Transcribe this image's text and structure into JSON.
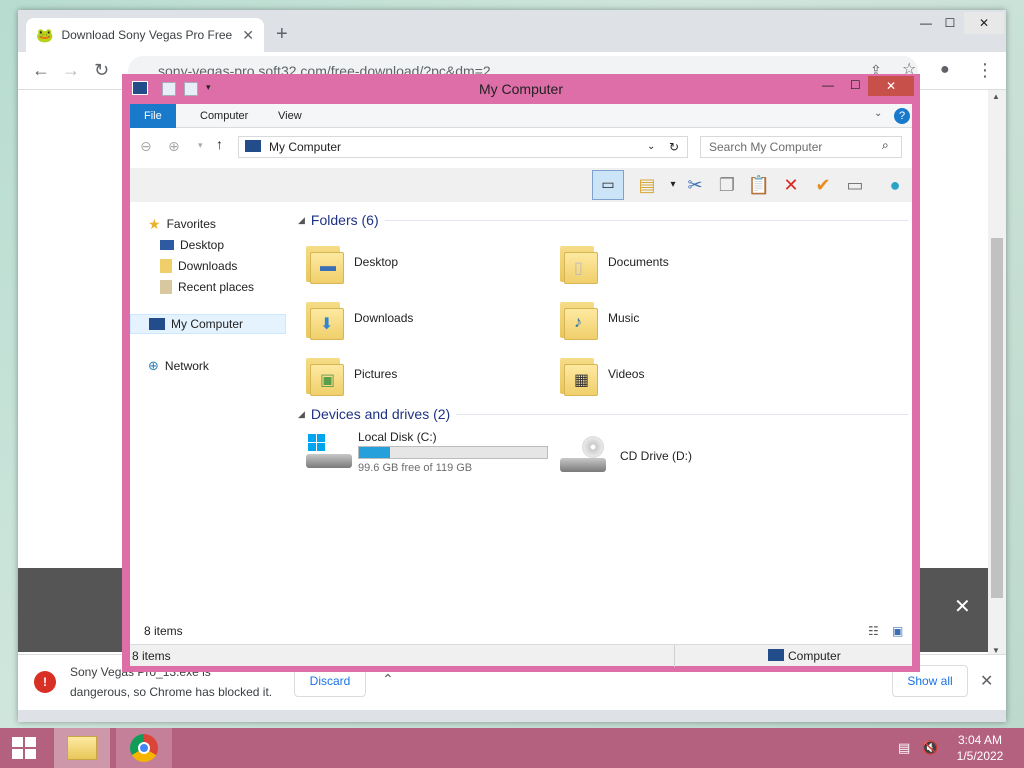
{
  "chrome": {
    "tab_title": "Download Sony Vegas Pro Free",
    "tab_close": "✕",
    "new_tab": "+",
    "url": "sony-vegas-pro.soft32.com/free-download/?pc&dm=2",
    "minimize": "—",
    "maximize": "☐",
    "close": "✕",
    "banner_close": "✕"
  },
  "download_bar": {
    "file_text_line1": "Sony Vegas Pro_13.exe is",
    "file_text_line2": "dangerous, so Chrome has blocked it.",
    "discard_label": "Discard",
    "show_all_label": "Show all",
    "close": "✕"
  },
  "explorer": {
    "title": "My Computer",
    "ribbon_tabs": [
      "File",
      "Computer",
      "View"
    ],
    "address": "My Computer",
    "search_placeholder": "Search My Computer",
    "nav": {
      "favorites": "Favorites",
      "desktop": "Desktop",
      "downloads": "Downloads",
      "recent": "Recent places",
      "my_computer": "My Computer",
      "network": "Network"
    },
    "folders_header": "Folders (6)",
    "folders": [
      "Desktop",
      "Documents",
      "Downloads",
      "Music",
      "Pictures",
      "Videos"
    ],
    "devices_header": "Devices and drives (2)",
    "drive_c": {
      "name": "Local Disk (C:)",
      "free": "99.6 GB free of 119 GB",
      "used_fraction": 0.163
    },
    "drive_d": {
      "name": "CD Drive (D:)"
    },
    "item_count": "8 items",
    "status_count": "8 items",
    "status_location": "Computer"
  },
  "taskbar": {
    "time": "3:04 AM",
    "date": "1/5/2022"
  },
  "colors": {
    "explorer_frame": "#dd6ea7",
    "taskbar": "#b4617f",
    "file_tab": "#1979ca",
    "drive_bar": "#26a0da"
  }
}
